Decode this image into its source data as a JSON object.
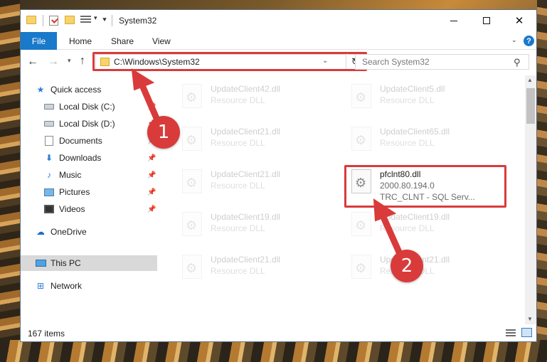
{
  "window": {
    "title": "System32"
  },
  "ribbon": {
    "file": "File",
    "home": "Home",
    "share": "Share",
    "view": "View"
  },
  "navbar": {
    "address": "C:\\Windows\\System32",
    "search_placeholder": "Search System32"
  },
  "sidebar": {
    "items": [
      {
        "label": "Quick access",
        "icon": "star-icon"
      },
      {
        "label": "Local Disk (C:)",
        "icon": "drive-icon"
      },
      {
        "label": "Local Disk (D:)",
        "icon": "drive-icon"
      },
      {
        "label": "Documents",
        "icon": "documents-icon"
      },
      {
        "label": "Downloads",
        "icon": "download-icon"
      },
      {
        "label": "Music",
        "icon": "music-icon"
      },
      {
        "label": "Pictures",
        "icon": "pictures-icon"
      },
      {
        "label": "Videos",
        "icon": "videos-icon"
      },
      {
        "label": "OneDrive",
        "icon": "cloud-icon"
      },
      {
        "label": "This PC",
        "icon": "computer-icon"
      },
      {
        "label": "Network",
        "icon": "network-icon"
      }
    ]
  },
  "files": [
    {
      "name": "UpdateClient42.dll",
      "desc": "Resource DLL"
    },
    {
      "name": "UpdateClient5.dll",
      "desc": "Resource DLL"
    },
    {
      "name": "UpdateClient21.dll",
      "desc": "Resource DLL"
    },
    {
      "name": "UpdateClient65.dll",
      "desc": "Resource DLL"
    },
    {
      "name": "UpdateClient21.dll",
      "desc": "Resource DLL"
    },
    {
      "name": "pfclnt80.dll",
      "desc": "2000.80.194.0",
      "desc2": "TRC_CLNT - SQL Serv..."
    },
    {
      "name": "UpdateClient19.dll",
      "desc": "Resource DLL"
    },
    {
      "name": "UpdateClient19.dll",
      "desc": "Resource DLL"
    },
    {
      "name": "UpdateClient21.dll",
      "desc": "Resource DLL"
    },
    {
      "name": "UpdateClient21.dll",
      "desc": "Resource DLL"
    }
  ],
  "status": {
    "count": "167 items"
  },
  "annotations": {
    "step1": "1",
    "step2": "2"
  },
  "colors": {
    "accent": "#1979ca",
    "highlight": "#d93b3b"
  }
}
